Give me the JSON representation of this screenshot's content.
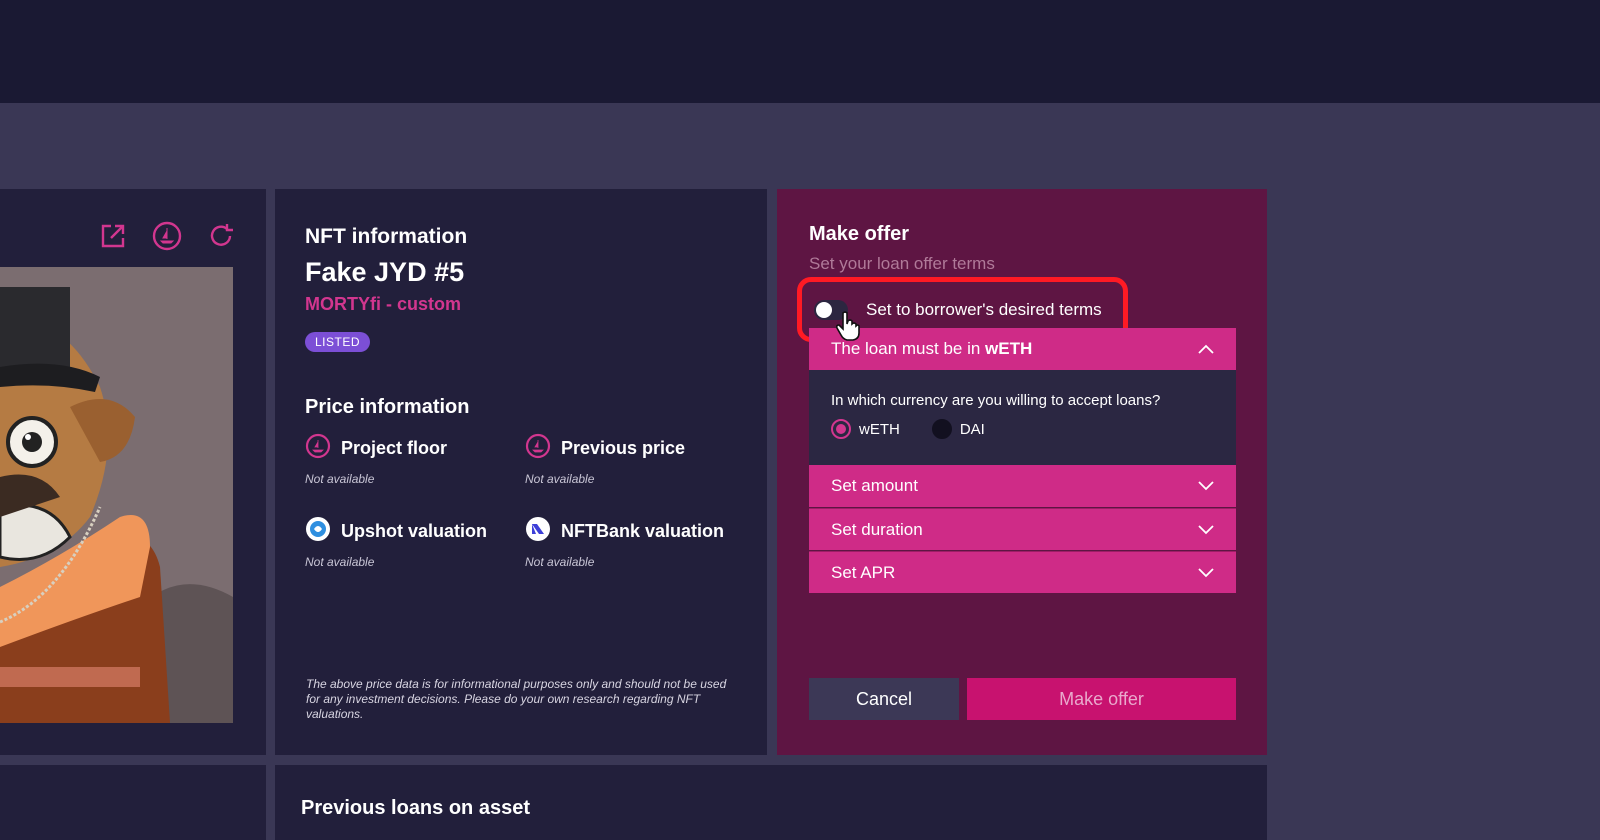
{
  "colors": {
    "background": "#3a3755",
    "panel": "#221f3b",
    "offer_panel": "#5e1543",
    "accent_pink": "#cf2b87",
    "highlight_red": "#ff1a24",
    "listed_badge": "#7c4fd6"
  },
  "image_panel": {
    "icons": [
      "external-link-icon",
      "opensea-icon",
      "refresh-icon"
    ]
  },
  "nft_info": {
    "title": "NFT information",
    "name": "Fake JYD #5",
    "collection": "MORTYfi - custom",
    "status_badge": "LISTED"
  },
  "price_info": {
    "title": "Price information",
    "items": [
      {
        "label": "Project floor",
        "value": "Not available",
        "icon": "opensea-icon"
      },
      {
        "label": "Previous price",
        "value": "Not available",
        "icon": "opensea-icon"
      },
      {
        "label": "Upshot valuation",
        "value": "Not available",
        "icon": "upshot-icon"
      },
      {
        "label": "NFTBank valuation",
        "value": "Not available",
        "icon": "nftbank-icon"
      }
    ],
    "disclaimer": "The above price data is for informational purposes only and should not be used for any investment decisions. Please do your own research regarding NFT valuations."
  },
  "offer": {
    "title": "Make offer",
    "subtitle": "Set your loan offer terms",
    "toggle_label": "Set to borrower's desired terms",
    "toggle_on": false,
    "currency_section": {
      "header_prefix": "The loan must be in ",
      "header_currency": "wETH",
      "question": "In which currency are you willing to accept loans?",
      "options": [
        "wETH",
        "DAI"
      ],
      "selected": "wETH"
    },
    "sections": [
      "Set amount",
      "Set duration",
      "Set APR"
    ],
    "cancel_label": "Cancel",
    "submit_label": "Make offer"
  },
  "previous_loans": {
    "title": "Previous loans on asset"
  }
}
